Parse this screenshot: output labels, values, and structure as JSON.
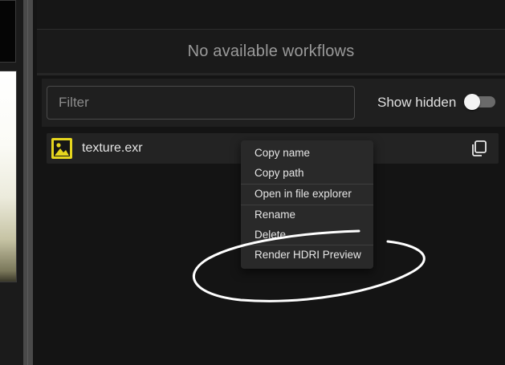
{
  "workflows": {
    "empty_message": "No available workflows"
  },
  "filter": {
    "placeholder": "Filter",
    "value": ""
  },
  "show_hidden": {
    "label": "Show hidden",
    "enabled": false
  },
  "files": [
    {
      "name": "texture.exr",
      "icon": "image-icon"
    }
  ],
  "context_menu": {
    "items": [
      {
        "label": "Copy name"
      },
      {
        "label": "Copy path"
      },
      {
        "label": "Open in file explorer"
      },
      {
        "label": "Rename"
      },
      {
        "label": "Delete"
      },
      {
        "label": "Render HDRI Preview"
      }
    ]
  },
  "colors": {
    "accent": "#e6d61e",
    "annotation": "#ffffff",
    "panel": "#1f1f1f"
  }
}
